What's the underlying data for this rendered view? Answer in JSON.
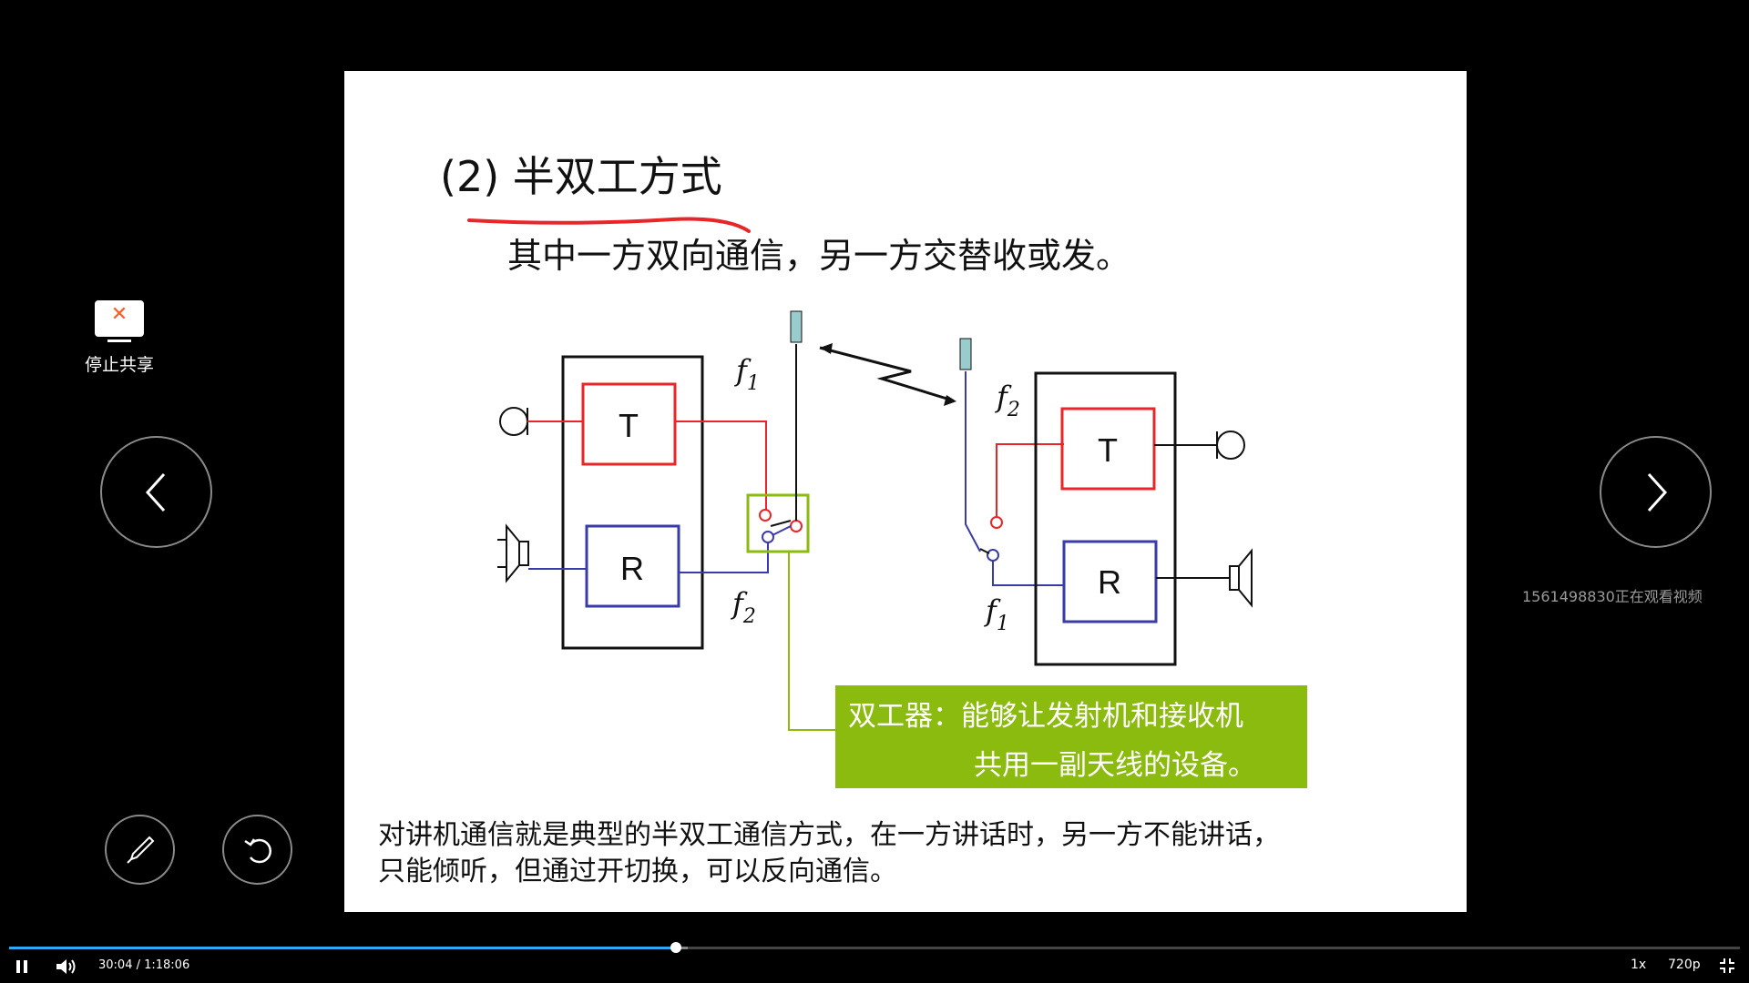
{
  "slide": {
    "title": "(2) 半双工方式",
    "subtitle": "其中一方双向通信，另一方交替收或发。",
    "diagram": {
      "left_transmitter": "T",
      "left_receiver": "R",
      "right_transmitter": "T",
      "right_receiver": "R",
      "f1_left": "f",
      "f1_left_sub": "1",
      "f2_left": "f",
      "f2_left_sub": "2",
      "f2_right": "f",
      "f2_right_sub": "2",
      "f1_right": "f",
      "f1_right_sub": "1"
    },
    "note_line1": "双工器：能够让发射机和接收机",
    "note_line2": "共用一副天线的设备。",
    "footer_line1": "对讲机通信就是典型的半双工通信方式，在一方讲话时，另一方不能讲话，",
    "footer_line2": "只能倾听，但通过开切换，可以反向通信。"
  },
  "controls": {
    "stop_share_label": "停止共享",
    "viewer_text": "1561498830正在观看视频"
  },
  "player": {
    "time": "30:04 / 1:18:06",
    "speed": "1x",
    "quality": "720p",
    "progress_fraction": 0.385,
    "buffer_fraction": 0.392
  },
  "colors": {
    "progress": "#2fa8f5",
    "transmitter": "#e8262a",
    "receiver": "#3a3aa8",
    "duplexer": "#8cbb10"
  }
}
